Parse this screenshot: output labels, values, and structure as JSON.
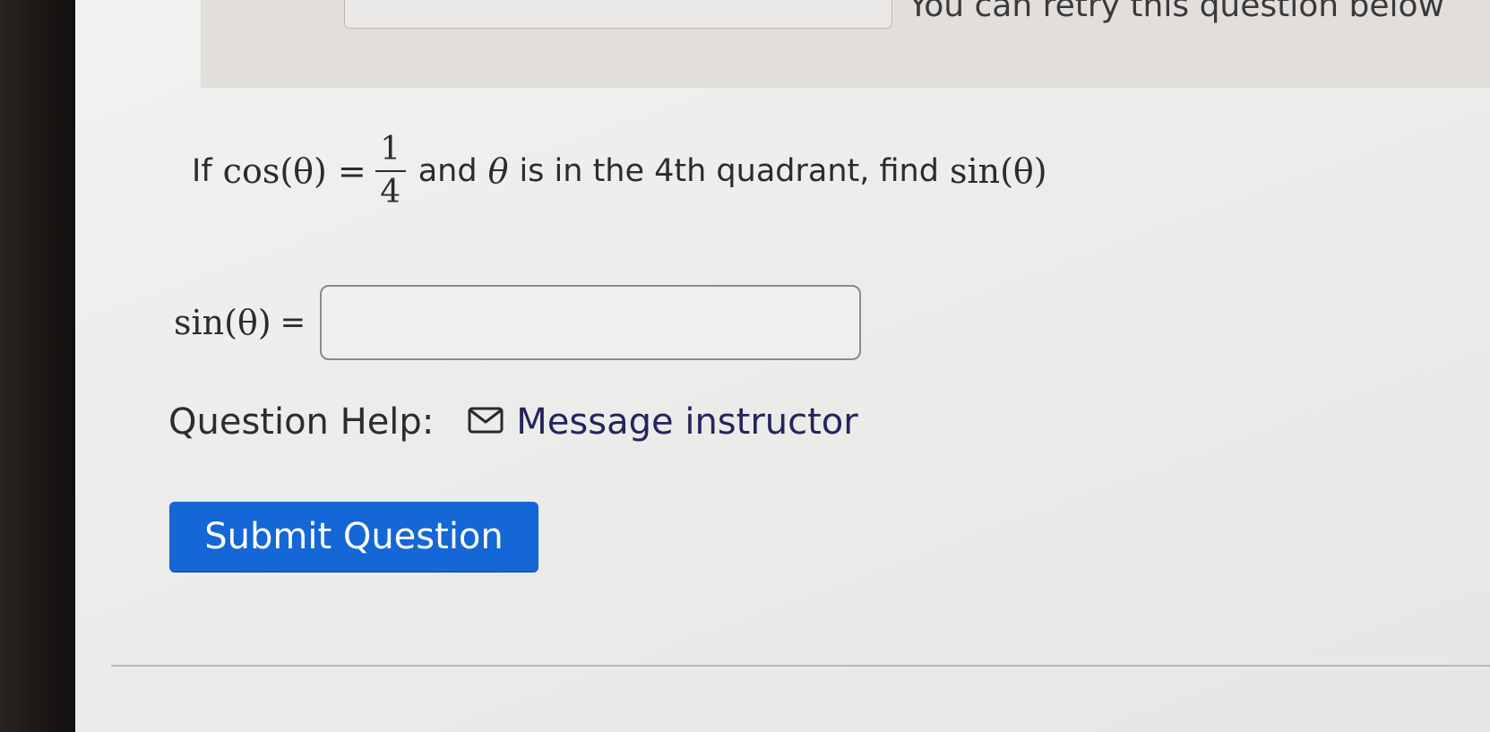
{
  "banner": {
    "retry_text": "You can retry this question below"
  },
  "question": {
    "prefix": "If",
    "cos_expr": "cos(θ)",
    "equals": "=",
    "numerator": "1",
    "denominator": "4",
    "middle": "and",
    "theta": "θ",
    "suffix": "is in the 4th quadrant, find",
    "sin_expr": "sin(θ)"
  },
  "answer": {
    "label": "sin(θ)",
    "equals": "=",
    "value": ""
  },
  "help": {
    "label": "Question Help:",
    "icon": "mail-icon",
    "link_text": "Message instructor"
  },
  "submit": {
    "label": "Submit Question"
  },
  "colors": {
    "submit_bg": "#1566d6",
    "link": "#24245e"
  }
}
